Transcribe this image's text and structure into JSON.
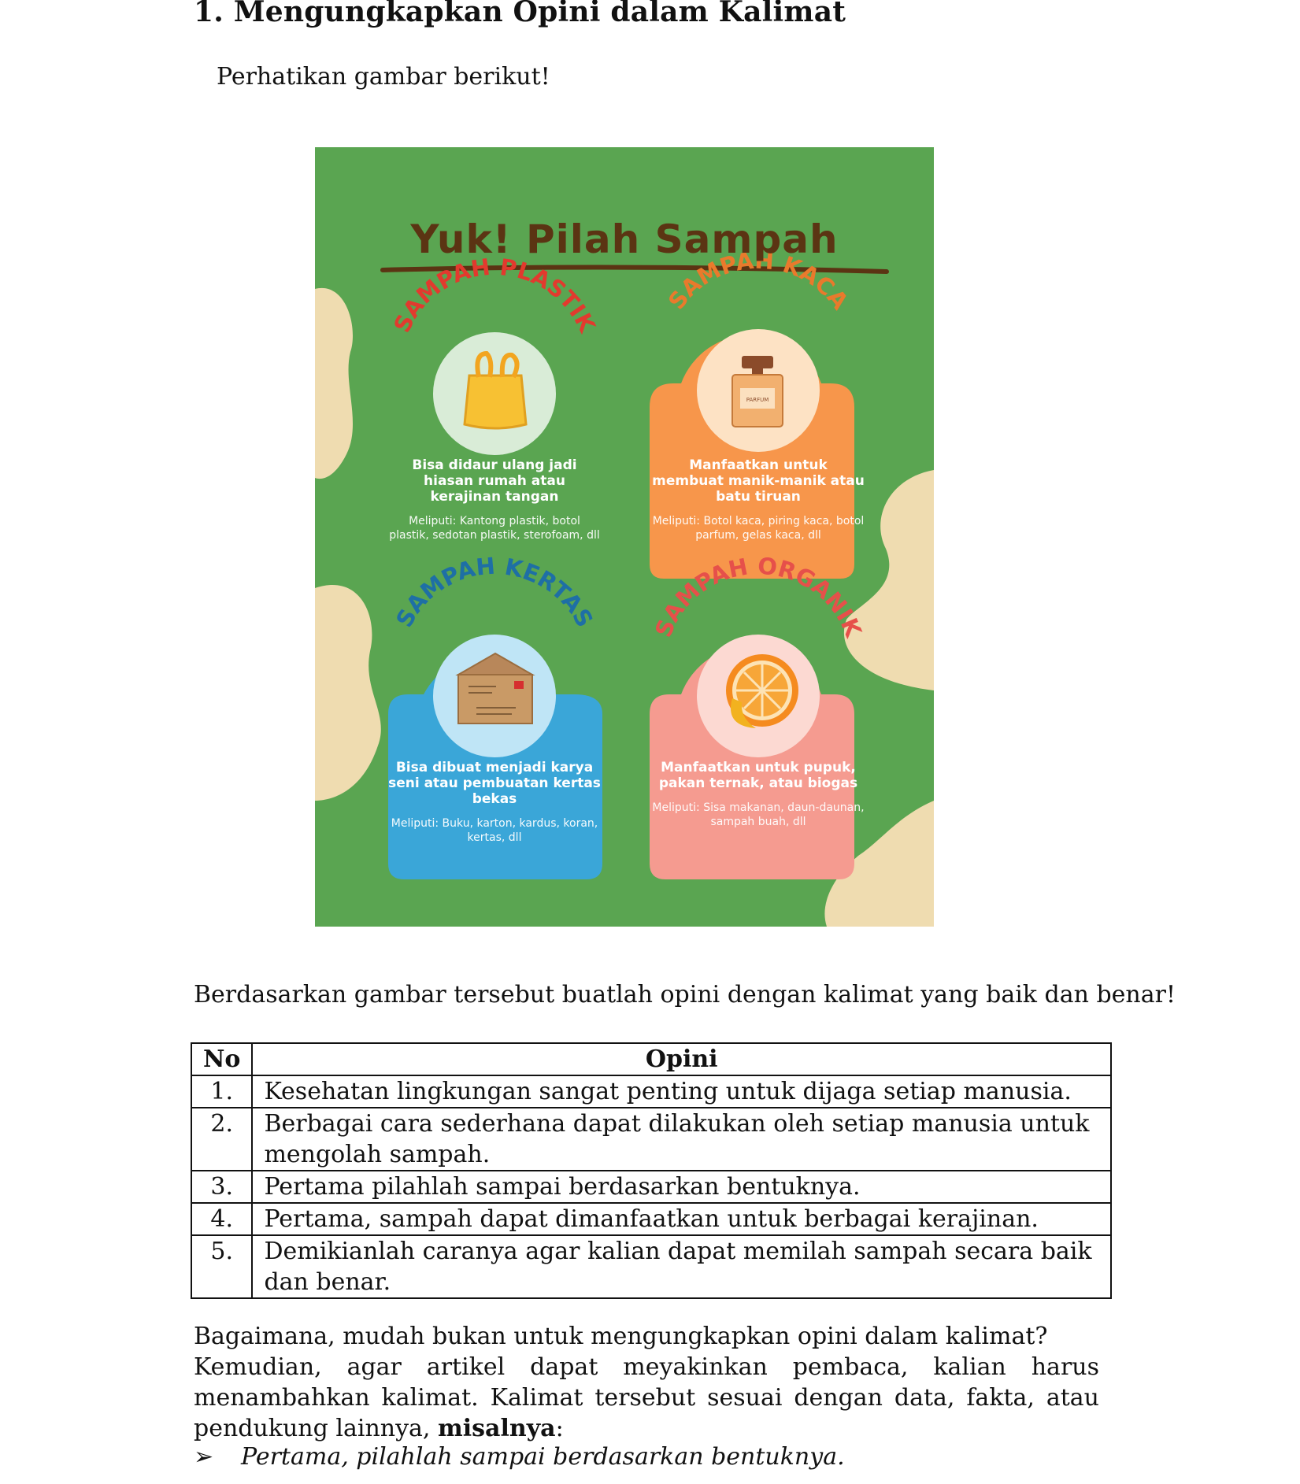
{
  "heading": "1. Mengungkapkan Opini dalam Kalimat",
  "intro": "Perhatikan gambar berikut!",
  "poster": {
    "title": "Yuk! Pilah Sampah",
    "cards": [
      {
        "label": "SAMPAH PLASTIK",
        "main": "Bisa didaur ulang jadi hiasan rumah atau kerajinan tangan",
        "sub": "Meliputi: Kantong plastik, botol plastik, sedotan plastik, sterofoam, dll",
        "color": "#e23a2e"
      },
      {
        "label": "SAMPAH KACA",
        "main": "Manfaatkan untuk membuat manik-manik atau batu tiruan",
        "sub": "Meliputi: Botol kaca, piring kaca, botol parfum, gelas kaca, dll",
        "color": "#e97a2c",
        "bottle_label": "PARFUM"
      },
      {
        "label": "SAMPAH KERTAS",
        "main": "Bisa dibuat menjadi karya seni atau pembuatan kertas bekas",
        "sub": "Meliputi: Buku, karton, kardus, koran, kertas, dll",
        "color": "#1e6fa5"
      },
      {
        "label": "SAMPAH ORGANIK",
        "main": "Manfaatkan untuk pupuk, pakan ternak, atau biogas",
        "sub": "Meliputi: Sisa makanan, daun-daunan, sampah buah, dll",
        "color": "#e6504a"
      }
    ]
  },
  "instruction": "Berdasarkan gambar tersebut buatlah opini dengan kalimat yang baik dan benar!",
  "table": {
    "headers": [
      "No",
      "Opini"
    ],
    "rows": [
      {
        "no": "1.",
        "text": "Kesehatan lingkungan  sangat penting untuk dijaga setiap manusia."
      },
      {
        "no": "2.",
        "text": "Berbagai cara sederhana dapat dilakukan oleh setiap manusia untuk mengolah sampah."
      },
      {
        "no": "3.",
        "text": "Pertama pilahlah sampai berdasarkan bentuknya."
      },
      {
        "no": "4.",
        "text": "Pertama, sampah dapat dimanfaatkan untuk berbagai kerajinan."
      },
      {
        "no": "5.",
        "text": "Demikianlah caranya agar kalian dapat memilah sampah secara baik dan benar."
      }
    ]
  },
  "paragraph": {
    "line1": "Bagaimana, mudah bukan untuk mengungkapkan opini dalam kalimat?",
    "line2": "Kemudian, agar artikel dapat meyakinkan pembaca, kalian harus menambahkan kalimat. Kalimat tersebut sesuai dengan data, fakta, atau pendukung lainnya,",
    "bold": "misalnya",
    "after_bold": ":"
  },
  "bullet": {
    "icon": "arrow-bullet-icon",
    "symbol": "➢",
    "text": "Pertama, pilahlah sampai berdasarkan bentuknya."
  }
}
